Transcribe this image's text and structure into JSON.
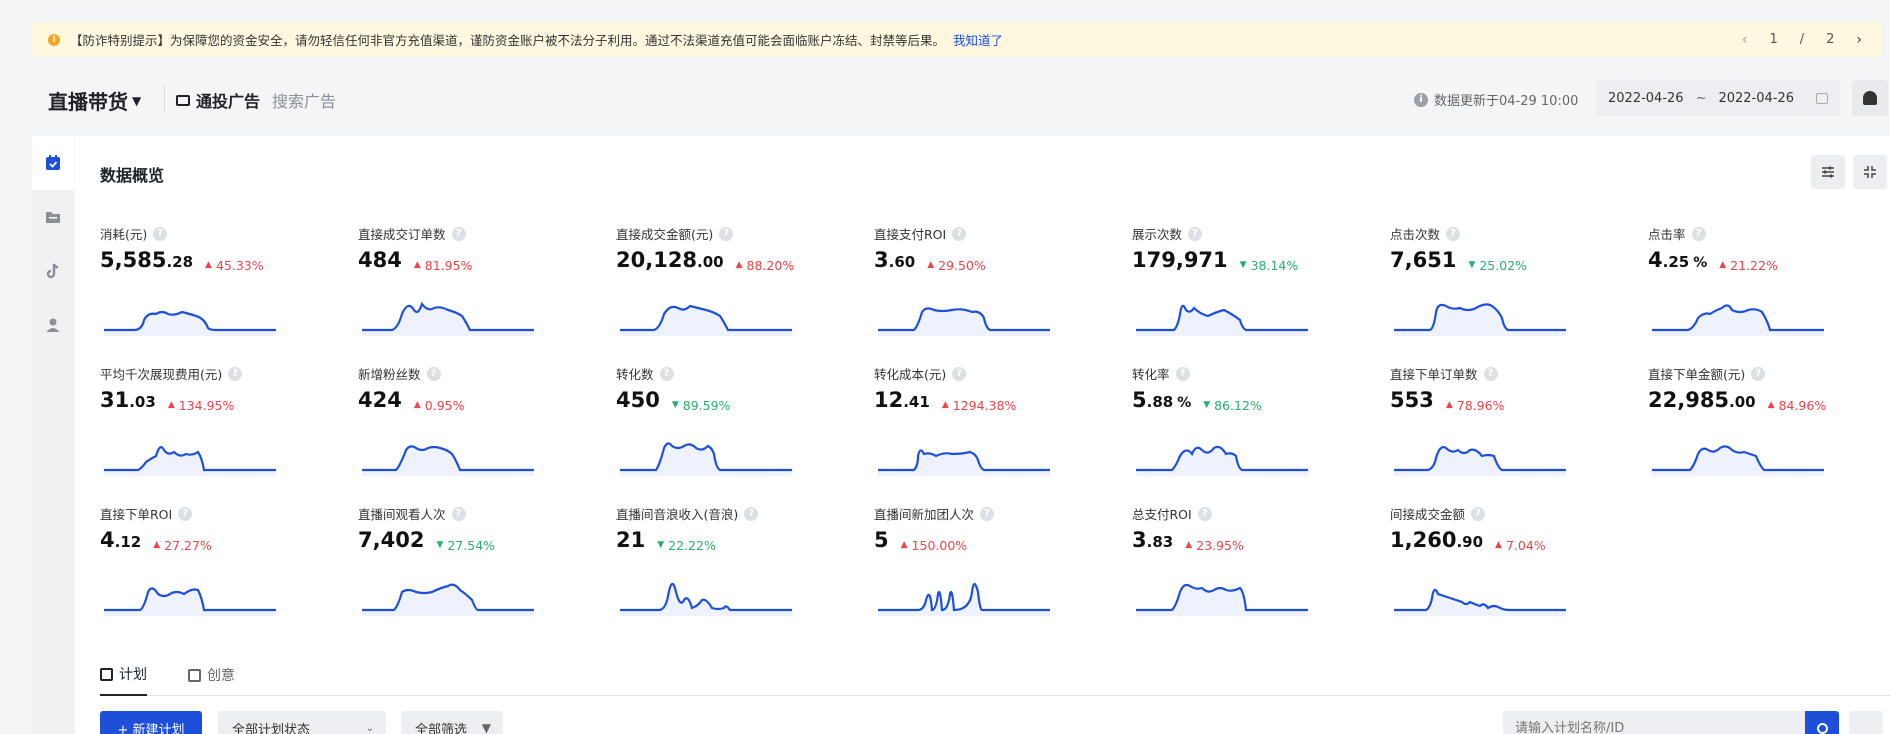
{
  "notice": {
    "text": "【防诈特别提示】为保障您的资金安全，请勿轻信任何非官方充值渠道，谨防资金账户被不法分子利用。通过不法渠道充值可能会面临账户冻结、封禁等后果。",
    "link": "我知道了",
    "page_current": "1",
    "page_sep": "/",
    "page_total": "2"
  },
  "header": {
    "title": "直播带货",
    "tab_general": "通投广告",
    "tab_search": "搜索广告",
    "update_info": "数据更新于04-29 10:00",
    "date_start": "2022-04-26",
    "date_sep": "~",
    "date_end": "2022-04-26"
  },
  "sidebar": {
    "items": [
      "calendar-icon",
      "folder-icon",
      "tiktok-icon",
      "user-icon"
    ],
    "active_index": 0
  },
  "overview": {
    "title": "数据概览",
    "metrics": [
      {
        "label": "消耗(元)",
        "int": "5,585",
        "dec": ".28",
        "unit": "",
        "dir": "up",
        "delta": "45.33%",
        "shape": "a"
      },
      {
        "label": "直接成交订单数",
        "int": "484",
        "dec": "",
        "unit": "",
        "dir": "up",
        "delta": "81.95%",
        "shape": "b"
      },
      {
        "label": "直接成交金额(元)",
        "int": "20,128",
        "dec": ".00",
        "unit": "",
        "dir": "up",
        "delta": "88.20%",
        "shape": "c"
      },
      {
        "label": "直接支付ROI",
        "int": "3",
        "dec": ".60",
        "unit": "",
        "dir": "up",
        "delta": "29.50%",
        "shape": "d"
      },
      {
        "label": "展示次数",
        "int": "179,971",
        "dec": "",
        "unit": "",
        "dir": "down",
        "delta": "38.14%",
        "shape": "e"
      },
      {
        "label": "点击次数",
        "int": "7,651",
        "dec": "",
        "unit": "",
        "dir": "down",
        "delta": "25.02%",
        "shape": "f"
      },
      {
        "label": "点击率",
        "int": "4",
        "dec": ".25",
        "unit": "%",
        "dir": "up",
        "delta": "21.22%",
        "shape": "g"
      },
      {
        "label": "平均千次展现费用(元)",
        "int": "31",
        "dec": ".03",
        "unit": "",
        "dir": "up",
        "delta": "134.95%",
        "shape": "h"
      },
      {
        "label": "新增粉丝数",
        "int": "424",
        "dec": "",
        "unit": "",
        "dir": "up",
        "delta": "0.95%",
        "shape": "i"
      },
      {
        "label": "转化数",
        "int": "450",
        "dec": "",
        "unit": "",
        "dir": "down",
        "delta": "89.59%",
        "shape": "j"
      },
      {
        "label": "转化成本(元)",
        "int": "12",
        "dec": ".41",
        "unit": "",
        "dir": "up",
        "delta": "1294.38%",
        "shape": "k"
      },
      {
        "label": "转化率",
        "int": "5",
        "dec": ".88",
        "unit": "%",
        "dir": "down",
        "delta": "86.12%",
        "shape": "l"
      },
      {
        "label": "直接下单订单数",
        "int": "553",
        "dec": "",
        "unit": "",
        "dir": "up",
        "delta": "78.96%",
        "shape": "m"
      },
      {
        "label": "直接下单金额(元)",
        "int": "22,985",
        "dec": ".00",
        "unit": "",
        "dir": "up",
        "delta": "84.96%",
        "shape": "n"
      },
      {
        "label": "直接下单ROI",
        "int": "4",
        "dec": ".12",
        "unit": "",
        "dir": "up",
        "delta": "27.27%",
        "shape": "o"
      },
      {
        "label": "直播间观看人次",
        "int": "7,402",
        "dec": "",
        "unit": "",
        "dir": "down",
        "delta": "27.54%",
        "shape": "p"
      },
      {
        "label": "直播间音浪收入(音浪)",
        "int": "21",
        "dec": "",
        "unit": "",
        "dir": "down",
        "delta": "22.22%",
        "shape": "q"
      },
      {
        "label": "直播间新加团人次",
        "int": "5",
        "dec": "",
        "unit": "",
        "dir": "up",
        "delta": "150.00%",
        "shape": "r"
      },
      {
        "label": "总支付ROI",
        "int": "3",
        "dec": ".83",
        "unit": "",
        "dir": "up",
        "delta": "23.95%",
        "shape": "s"
      },
      {
        "label": "间接成交金额",
        "int": "1,260",
        "dec": ".90",
        "unit": "",
        "dir": "up",
        "delta": "7.04%",
        "shape": "t"
      }
    ]
  },
  "tabs": {
    "plan": "计划",
    "creative": "创意"
  },
  "toolbar": {
    "new_plan": "+ 新建计划",
    "status_select": "全部计划状态",
    "filter": "全部筛选",
    "search_placeholder": "请输入计划名称/ID"
  },
  "colors": {
    "accent": "#1d4fd8",
    "up": "#e8464a",
    "down": "#2bae6e",
    "notice_bg": "#fff8e1"
  }
}
